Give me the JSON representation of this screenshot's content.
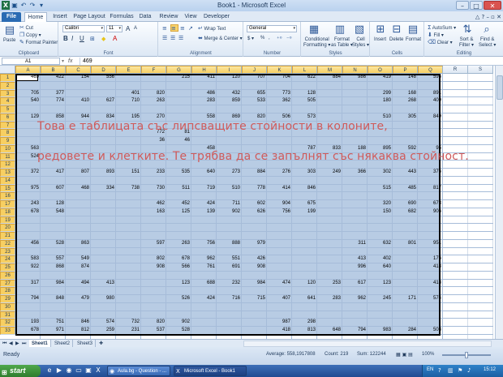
{
  "titlebar": {
    "title": "Book1 - Microsoft Excel",
    "qat_icons": [
      "excel-logo-icon",
      "save-icon",
      "undo-icon",
      "redo-icon",
      "customize-icon"
    ],
    "window_buttons": {
      "minimize": "–",
      "maximize": "□",
      "close": "✕"
    }
  },
  "tabs": [
    "File",
    "Home",
    "Insert",
    "Page Layout",
    "Formulas",
    "Data",
    "Review",
    "View",
    "Developer"
  ],
  "active_tab": "Home",
  "ribbon": {
    "clipboard": {
      "label": "Clipboard",
      "paste": "Paste",
      "cut": "Cut",
      "copy": "Copy ▾",
      "format_painter": "Format Painter"
    },
    "font": {
      "label": "Font",
      "name": "Calibri",
      "size": "11",
      "bold": "B",
      "italic": "I",
      "underline": "U",
      "grow": "A",
      "shrink": "A"
    },
    "alignment": {
      "label": "Alignment",
      "wrap": "Wrap Text",
      "merge": "Merge & Center ▾"
    },
    "number": {
      "label": "Number",
      "format": "General",
      "currency": "$ ▾",
      "percent": "%",
      "comma": ","
    },
    "styles": {
      "label": "Styles",
      "conditional": "Conditional",
      "conditional2": "Formatting ▾",
      "table": "Format",
      "table2": "as Table ▾",
      "cell": "Cell",
      "cell2": "Styles ▾"
    },
    "cells": {
      "label": "Cells",
      "insert": "Insert",
      "delete": "Delete",
      "format": "Format"
    },
    "editing": {
      "label": "Editing",
      "autosum": "AutoSum ▾",
      "fill": "Fill ▾",
      "clear": "Clear ▾",
      "sort": "Sort &",
      "sort2": "Filter ▾",
      "find": "Find &",
      "find2": "Select ▾"
    }
  },
  "formula_bar": {
    "name_box": "A1",
    "fx": "fx",
    "value": "469"
  },
  "columns": [
    "A",
    "B",
    "C",
    "D",
    "E",
    "F",
    "G",
    "H",
    "I",
    "J",
    "K",
    "L",
    "M",
    "N",
    "O",
    "P",
    "Q",
    "R",
    "S"
  ],
  "rows": [
    {
      "n": "1",
      "cells": {
        "A": "469",
        "B": "422",
        "C": "154",
        "D": "556",
        "G": "215",
        "H": "411",
        "I": "120",
        "J": "707",
        "K": "704",
        "L": "622",
        "M": "884",
        "N": "986",
        "O": "419",
        "P": "148",
        "Q": "596"
      }
    },
    {
      "n": "2",
      "cells": {}
    },
    {
      "n": "3",
      "cells": {
        "A": "705",
        "B": "377",
        "E": "401",
        "F": "820",
        "H": "486",
        "I": "432",
        "J": "655",
        "K": "773",
        "L": "128",
        "O": "299",
        "P": "168",
        "Q": "891"
      }
    },
    {
      "n": "4",
      "cells": {
        "A": "540",
        "B": "774",
        "C": "410",
        "D": "627",
        "E": "710",
        "F": "263",
        "H": "283",
        "I": "859",
        "J": "533",
        "K": "362",
        "L": "505",
        "O": "180",
        "P": "268",
        "Q": "409"
      }
    },
    {
      "n": "5",
      "cells": {}
    },
    {
      "n": "6",
      "cells": {
        "A": "129",
        "B": "858",
        "C": "944",
        "D": "834",
        "E": "195",
        "F": "270",
        "H": "558",
        "I": "869",
        "J": "820",
        "K": "506",
        "L": "573",
        "O": "510",
        "P": "305",
        "Q": "849"
      }
    },
    {
      "n": "7",
      "cells": {}
    },
    {
      "n": "8",
      "cells": {
        "F": "772",
        "G": "81"
      }
    },
    {
      "n": "9",
      "cells": {
        "F": "36",
        "G": "46"
      }
    },
    {
      "n": "10",
      "cells": {
        "A": "563",
        "H": "458",
        "L": "787",
        "M": "833",
        "N": "188",
        "O": "895",
        "P": "592",
        "Q": "95"
      }
    },
    {
      "n": "11",
      "cells": {
        "A": "524"
      }
    },
    {
      "n": "12",
      "cells": {}
    },
    {
      "n": "13",
      "cells": {
        "A": "372",
        "B": "417",
        "C": "807",
        "D": "893",
        "E": "151",
        "F": "233",
        "G": "535",
        "H": "640",
        "I": "273",
        "J": "884",
        "K": "276",
        "L": "303",
        "M": "249",
        "N": "366",
        "O": "302",
        "P": "443",
        "Q": "376"
      }
    },
    {
      "n": "14",
      "cells": {}
    },
    {
      "n": "15",
      "cells": {
        "A": "975",
        "B": "607",
        "C": "468",
        "D": "334",
        "E": "738",
        "F": "730",
        "G": "511",
        "H": "719",
        "I": "510",
        "J": "778",
        "K": "414",
        "L": "846",
        "O": "515",
        "P": "485",
        "Q": "817"
      }
    },
    {
      "n": "16",
      "cells": {}
    },
    {
      "n": "17",
      "cells": {
        "A": "243",
        "B": "128",
        "F": "462",
        "G": "452",
        "H": "424",
        "I": "711",
        "J": "602",
        "K": "904",
        "L": "675",
        "O": "320",
        "P": "690",
        "Q": "673"
      }
    },
    {
      "n": "18",
      "cells": {
        "A": "678",
        "B": "548",
        "F": "163",
        "G": "125",
        "H": "139",
        "I": "902",
        "J": "626",
        "K": "756",
        "L": "199",
        "O": "150",
        "P": "682",
        "Q": "906"
      }
    },
    {
      "n": "19",
      "cells": {}
    },
    {
      "n": "20",
      "cells": {}
    },
    {
      "n": "21",
      "cells": {}
    },
    {
      "n": "22",
      "cells": {
        "A": "456",
        "B": "528",
        "C": "863",
        "F": "597",
        "G": "263",
        "H": "756",
        "I": "888",
        "J": "979",
        "N": "311",
        "O": "632",
        "P": "801",
        "Q": "951"
      }
    },
    {
      "n": "23",
      "cells": {}
    },
    {
      "n": "24",
      "cells": {
        "A": "583",
        "B": "557",
        "C": "549",
        "F": "802",
        "G": "678",
        "H": "962",
        "I": "551",
        "J": "426",
        "N": "413",
        "O": "402",
        "Q": "176"
      }
    },
    {
      "n": "25",
      "cells": {
        "A": "922",
        "B": "868",
        "C": "874",
        "F": "908",
        "G": "566",
        "H": "761",
        "I": "691",
        "J": "908",
        "N": "996",
        "O": "640",
        "Q": "418"
      }
    },
    {
      "n": "26",
      "cells": {}
    },
    {
      "n": "27",
      "cells": {
        "A": "317",
        "B": "984",
        "C": "494",
        "D": "413",
        "G": "123",
        "H": "688",
        "I": "232",
        "J": "984",
        "K": "474",
        "L": "120",
        "M": "253",
        "N": "617",
        "O": "123",
        "Q": "418"
      }
    },
    {
      "n": "28",
      "cells": {}
    },
    {
      "n": "29",
      "cells": {
        "A": "794",
        "B": "848",
        "C": "479",
        "D": "980",
        "G": "526",
        "H": "424",
        "I": "716",
        "J": "715",
        "K": "407",
        "L": "641",
        "M": "283",
        "N": "962",
        "O": "245",
        "P": "171",
        "Q": "574"
      }
    },
    {
      "n": "30",
      "cells": {}
    },
    {
      "n": "31",
      "cells": {}
    },
    {
      "n": "32",
      "cells": {
        "A": "193",
        "B": "751",
        "C": "846",
        "D": "574",
        "E": "732",
        "F": "820",
        "G": "902",
        "K": "987",
        "L": "298"
      }
    },
    {
      "n": "33",
      "cells": {
        "A": "678",
        "B": "971",
        "C": "812",
        "D": "259",
        "E": "231",
        "F": "537",
        "G": "528",
        "K": "418",
        "L": "813",
        "M": "648",
        "N": "794",
        "O": "983",
        "P": "284",
        "Q": "503"
      }
    }
  ],
  "overlay": {
    "line1": "Това е таблицата със липсващите стойности в колоните,",
    "line2": "редовете и клетките. Те трябва да се запълнят със някаква стойност."
  },
  "sheets": [
    "Sheet1",
    "Sheet2",
    "Sheet3"
  ],
  "active_sheet": "Sheet1",
  "status": {
    "ready": "Ready",
    "average": "Average: 558,1917808",
    "count": "Count: 219",
    "sum": "Sum: 122244",
    "zoom": "100%"
  },
  "taskbar": {
    "start": "start",
    "windows": [
      "Aula.bg - Question - ...",
      "Microsoft Excel - Book1"
    ],
    "lang": "EN",
    "clock": "15:12"
  }
}
